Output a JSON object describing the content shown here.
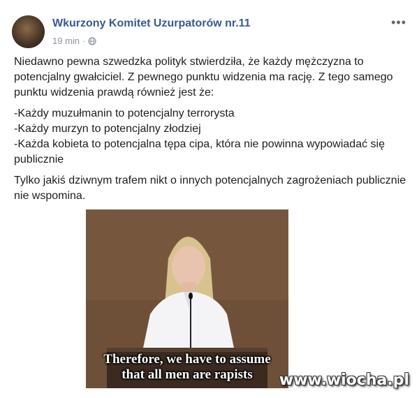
{
  "post": {
    "author": "Wkurzony Komitet Uzurpatorów nr.11",
    "time": "19 min",
    "separator": "·",
    "more_icon": "more-dots-icon",
    "privacy_icon": "globe-icon",
    "paragraph1": "Niedawno pewna szwedzka polityk stwierdziła, że każdy mężczyzna to potencjalny gwałciciel. Z pewnego punktu widzenia ma rację. Z tego samego punktu widzenia prawdą również jest że:",
    "list": [
      "-Każdy muzułmanin to potencjalny terrorysta",
      "-Każdy murzyn to potencjalny złodziej",
      "-Każda kobieta to potencjalna tępa cipa, która nie powinna wypowiadać się publicznie"
    ],
    "paragraph2": "Tylko jakiś dziwnym trafem nikt o innych potencjalnych zagrożeniach publicznie nie wspomina."
  },
  "image": {
    "subtitle_line1": "Therefore, we have to assume",
    "subtitle_line2": "that all men are rapists"
  },
  "watermark": "www.wiocha.pl",
  "colors": {
    "author": "#385898",
    "meta": "#8d949e",
    "text": "#1c1e21"
  }
}
